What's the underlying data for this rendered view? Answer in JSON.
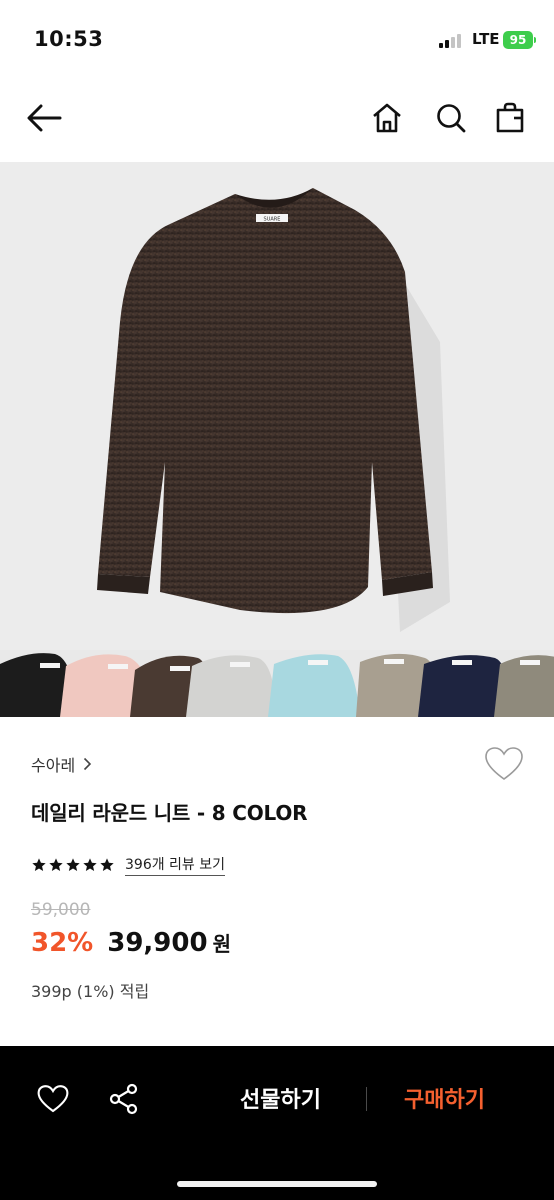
{
  "status_bar": {
    "time": "10:53",
    "network": "LTE",
    "battery": "95",
    "battery_color": "#3ecd4c"
  },
  "nav": {
    "icons": [
      "back-arrow-icon",
      "home-icon",
      "search-icon",
      "bag-icon"
    ]
  },
  "product": {
    "brand": "수아레",
    "title": "데일리 라운드 니트 - 8 COLOR",
    "garment_label": "SUARE",
    "rating_stars": 5,
    "review_link": "396개 리뷰 보기",
    "original_price": "59,000",
    "discount": "32%",
    "sale_price": "39,900",
    "currency": "원",
    "points": "399p (1%) 적립",
    "colors": [
      "#1c1c1c",
      "#f0c8c0",
      "#4a3a32",
      "#d3d3d1",
      "#a8d8e0",
      "#a89f90",
      "#1e2440",
      "#8f8a7c"
    ]
  },
  "bottom_bar": {
    "gift_label": "선물하기",
    "buy_label": "구매하기",
    "accent": "#f5602f"
  }
}
